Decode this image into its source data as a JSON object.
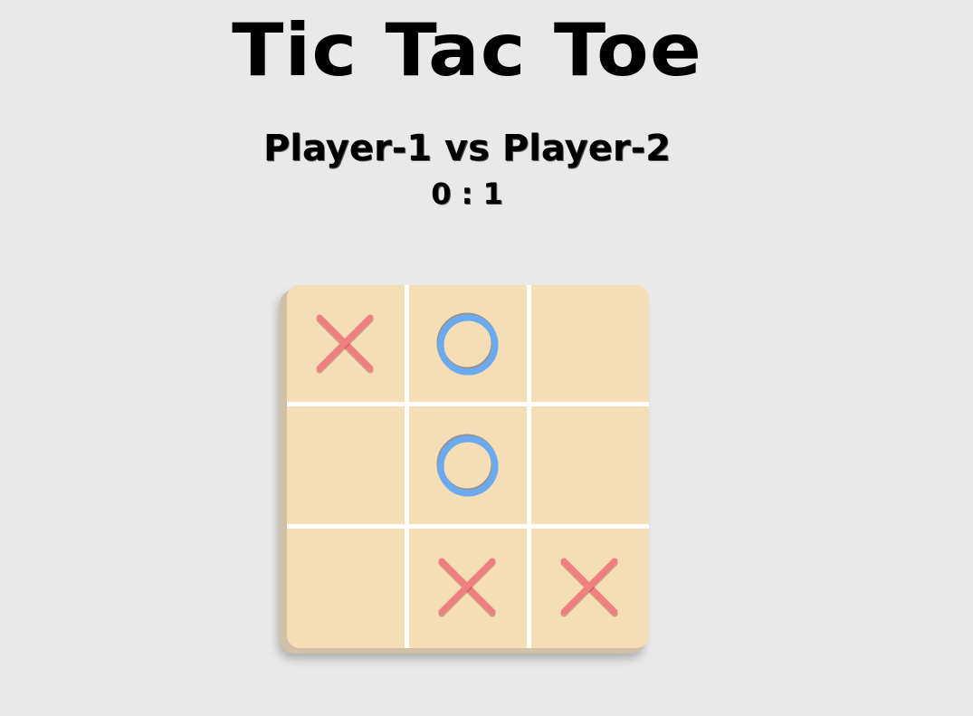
{
  "title": "Tic Tac Toe",
  "matchup": "Player-1 vs Player-2",
  "score": "0 : 1",
  "colors": {
    "background": "#e9e9e9",
    "board": "#f5ddb5",
    "grid": "#ffffff",
    "x_mark": "#f08080",
    "o_mark": "#6aaaf0"
  },
  "board": {
    "cells": [
      "X",
      "O",
      "",
      "",
      "O",
      "",
      "",
      "X",
      "X"
    ]
  }
}
